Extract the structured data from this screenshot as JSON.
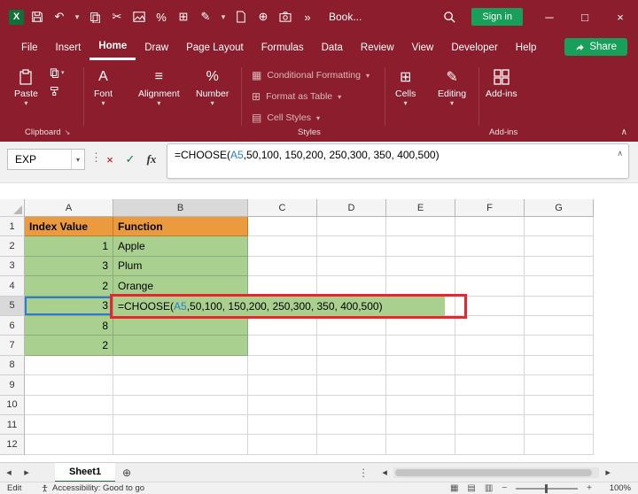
{
  "colors": {
    "titlebar_red": "#8B1D2D",
    "accent_green": "#18A05A",
    "header_orange": "#EC9A3E",
    "cell_green": "#A9D08E",
    "reference_blue": "#2B7CD3",
    "highlight_red": "#E8262D"
  },
  "icons": {
    "logo": "X",
    "caret_down": "▾",
    "undo": "↶",
    "cut": "✂",
    "pen": "✎",
    "plus_circle": "⊕",
    "more": "»",
    "minimize": "─",
    "maximize": "□",
    "close": "×",
    "dots_v": "⋮",
    "cancel": "×",
    "enter": "✓",
    "fx": "fx",
    "collapse": "∧",
    "align": "≡",
    "font": "A",
    "percent": "%",
    "cond_fmt": "▦",
    "table": "⊞",
    "cell_styles": "▤",
    "cells": "⊞",
    "editing": "✎",
    "addins": "⊞",
    "dialog_launcher": "↘",
    "tab_left": "◂",
    "tab_right": "▸",
    "add_sheet": "⊕",
    "view_normal": "▦",
    "view_layout": "▤",
    "view_break": "▥",
    "zoom_out": "−",
    "zoom_in": "+",
    "scroll_left": "◂",
    "scroll_right": "▸"
  },
  "titlebar": {
    "workbook_name": "Book...",
    "sign_in_label": "Sign in"
  },
  "menubar": {
    "tabs": [
      {
        "label": "File"
      },
      {
        "label": "Insert"
      },
      {
        "label": "Home"
      },
      {
        "label": "Draw"
      },
      {
        "label": "Page Layout"
      },
      {
        "label": "Formulas"
      },
      {
        "label": "Data"
      },
      {
        "label": "Review"
      },
      {
        "label": "View"
      },
      {
        "label": "Developer"
      },
      {
        "label": "Help"
      }
    ],
    "active_tab": "Home",
    "share_label": "Share"
  },
  "ribbon": {
    "paste": "Paste",
    "font": "Font",
    "alignment": "Alignment",
    "number": "Number",
    "conditional_formatting": "Conditional Formatting",
    "format_as_table": "Format as Table",
    "cell_styles": "Cell Styles",
    "cells": "Cells",
    "editing": "Editing",
    "addins": "Add-ins",
    "labels": {
      "clipboard": "Clipboard",
      "styles": "Styles",
      "addins": "Add-ins"
    }
  },
  "formula_bar": {
    "name_box_value": "EXP"
  },
  "grid": {
    "col_headers": [
      "A",
      "B",
      "C",
      "D",
      "E",
      "F",
      "G"
    ],
    "row_headers": [
      "1",
      "2",
      "3",
      "4",
      "5",
      "6",
      "7",
      "8",
      "9",
      "10",
      "11",
      "12"
    ],
    "header_row": {
      "a": "Index Value",
      "b": "Function"
    },
    "rows": [
      {
        "a": "1",
        "b": "Apple"
      },
      {
        "a": "3",
        "b": "Plum"
      },
      {
        "a": "2",
        "b": "Orange"
      },
      {
        "a": "3",
        "b": ""
      },
      {
        "a": "8",
        "b": ""
      },
      {
        "a": "2",
        "b": ""
      }
    ],
    "formula_cell": {
      "pre": "=CHOOSE(",
      "ref": "A5",
      "post": ",50,100, 150,200, 250,300, 350, 400,500)"
    }
  },
  "sheet_bar": {
    "active_tab": "Sheet1"
  },
  "status_bar": {
    "mode": "Edit",
    "accessibility": "Accessibility: Good to go",
    "zoom": "100%"
  }
}
